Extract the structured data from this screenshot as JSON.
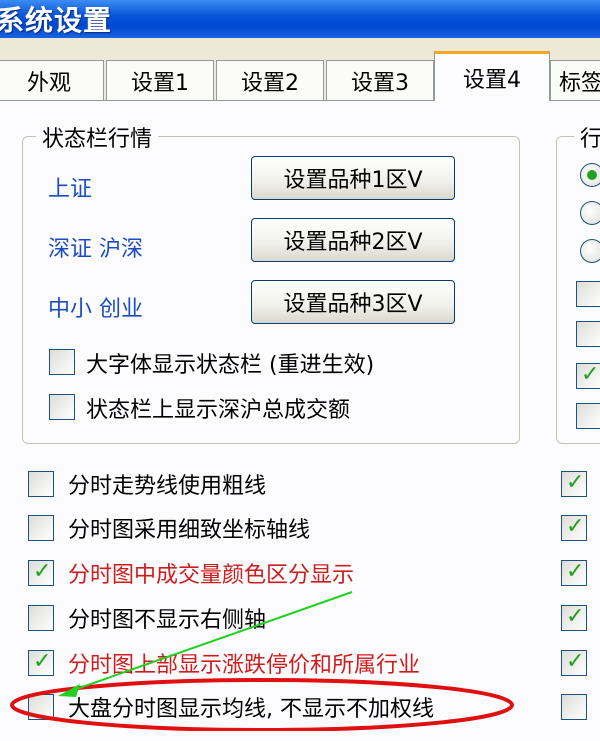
{
  "window": {
    "title": "系统设置"
  },
  "tabs": [
    {
      "label": "外观"
    },
    {
      "label": "设置1"
    },
    {
      "label": "设置2"
    },
    {
      "label": "设置3"
    },
    {
      "label": "设置4"
    },
    {
      "label": "标签"
    }
  ],
  "active_tab": "设置4",
  "status_group": {
    "legend": "状态栏行情",
    "rows": [
      {
        "label": "上证",
        "button": "设置品种1区V"
      },
      {
        "label": "深证 沪深",
        "button": "设置品种2区V"
      },
      {
        "label": "中小 创业",
        "button": "设置品种3区V"
      }
    ],
    "options": [
      {
        "label": "大字体显示状态栏 (重进生效)",
        "checked": false
      },
      {
        "label": "状态栏上显示深沪总成交额",
        "checked": false
      }
    ]
  },
  "right_group": {
    "legend": "行"
  },
  "options": [
    {
      "label": "分时走势线使用粗线",
      "checked": false,
      "color": "#000000"
    },
    {
      "label": "分时图采用细致坐标轴线",
      "checked": false,
      "color": "#000000"
    },
    {
      "label": "分时图中成交量颜色区分显示",
      "checked": true,
      "color": "#d01c1c"
    },
    {
      "label": "分时图不显示右侧轴",
      "checked": false,
      "color": "#000000"
    },
    {
      "label": "分时图上部显示涨跌停价和所属行业",
      "checked": true,
      "color": "#d01c1c"
    },
    {
      "label": "大盘分时图显示均线, 不显示不加权线",
      "checked": false,
      "color": "#000000"
    }
  ],
  "colors": {
    "title_bar": "#0a56d8",
    "blue_label": "#1c4cc4",
    "red_label": "#d01c1c",
    "check_green": "#21a121",
    "annotation_red": "#e01010",
    "annotation_green": "#20d020"
  }
}
